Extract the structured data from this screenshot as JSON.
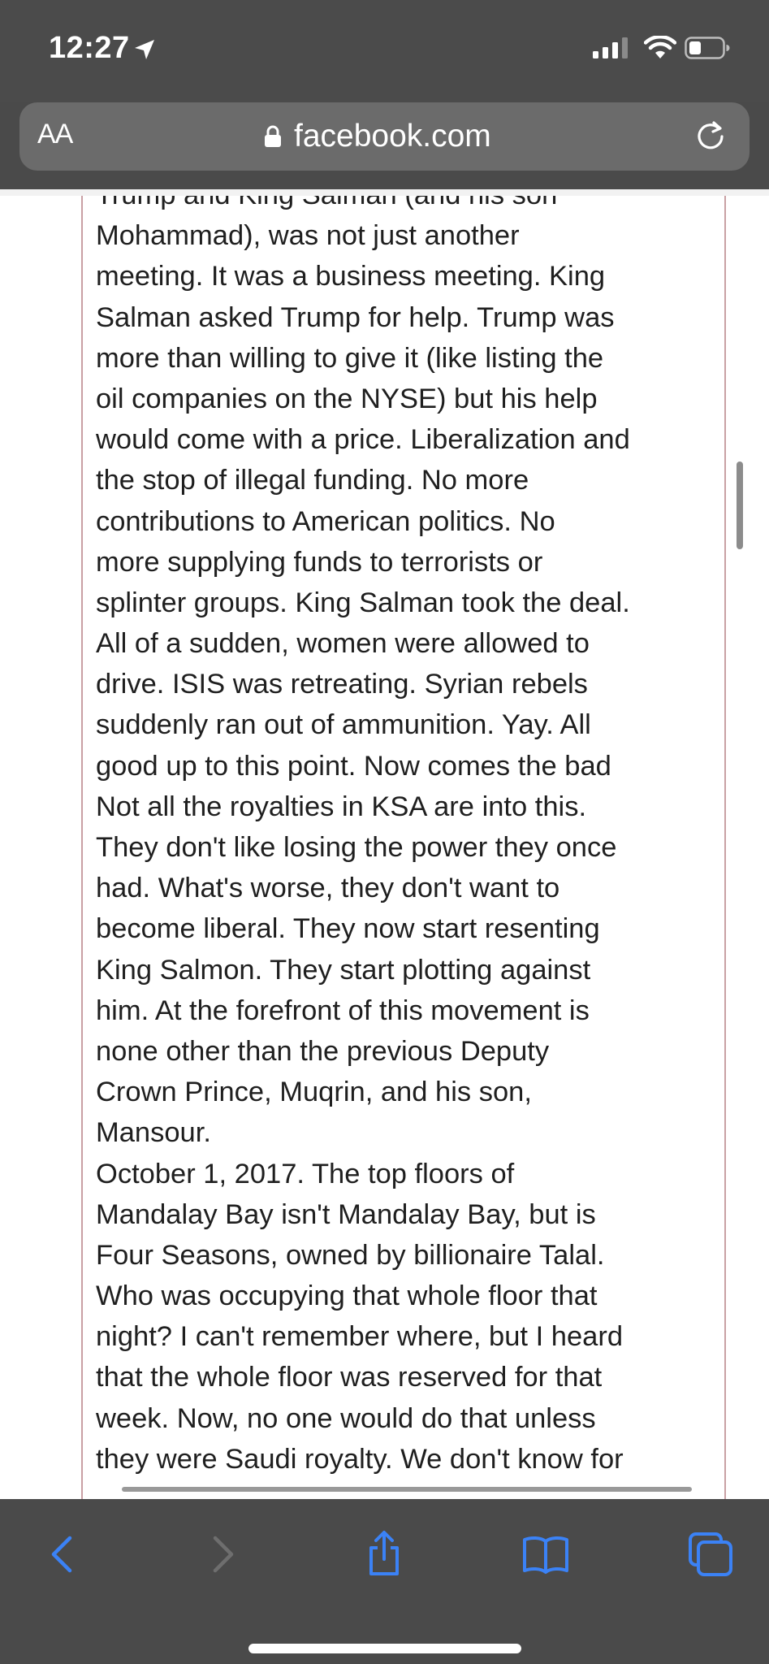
{
  "status_bar": {
    "time": "12:27",
    "location_icon": "location-arrow-icon",
    "signal_icon": "cellular-signal-icon",
    "wifi_icon": "wifi-icon",
    "battery_icon": "battery-icon"
  },
  "address_bar": {
    "text_size_label": "AA",
    "lock_icon": "lock-icon",
    "url": "facebook.com",
    "reload_icon": "reload-icon"
  },
  "post": {
    "lines": [
      "Trump and King Salman (and his son",
      "Mohammad), was not just another",
      "meeting. It was a business meeting. King",
      "Salman asked Trump for help. Trump was",
      "more than willing to give it (like listing the",
      "oil companies on the NYSE) but his help",
      "would come with a price. Liberalization and",
      "the stop of illegal funding. No more",
      "contributions to American politics. No",
      "more supplying funds to terrorists or",
      "splinter groups. King Salman took the deal.",
      "All of a sudden, women were allowed to",
      "drive. ISIS was retreating. Syrian rebels",
      "suddenly ran out of ammunition. Yay. All",
      "good up to this point. Now comes the bad",
      "Not all the royalties in KSA are into this.",
      "They don't like losing the power they once",
      "had. What's worse, they don't want to",
      "become liberal. They now start resenting",
      "King Salmon. They start plotting against",
      "him. At the forefront of this movement is",
      "none other than the previous Deputy",
      "Crown Prince, Muqrin, and his son,",
      "Mansour.",
      "October 1, 2017. The top floors of",
      "Mandalay Bay isn't Mandalay Bay, but is",
      "Four Seasons, owned by billionaire Talal.",
      "Who was occupying that whole floor that",
      "night? I can't remember where, but I heard",
      "that the whole floor was reserved for that",
      "week. Now, no one would do that unless",
      "they were Saudi royalty. We don't know for"
    ]
  },
  "toolbar": {
    "back_icon": "chevron-left-icon",
    "forward_icon": "chevron-right-icon",
    "share_icon": "share-icon",
    "bookmarks_icon": "book-icon",
    "tabs_icon": "tabs-icon"
  },
  "colors": {
    "chrome": "#4a4a4a",
    "address_bar": "#6b6b6b",
    "accent": "#3b82f6",
    "post_border": "#c9a0a4"
  }
}
